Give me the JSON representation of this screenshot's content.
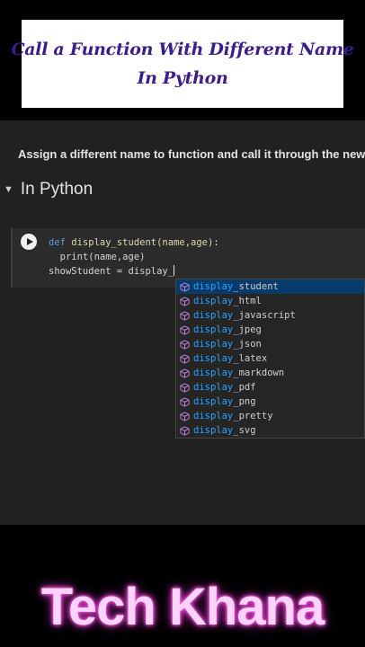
{
  "title": {
    "line1": "Call a Function With Different  Name",
    "line2": "In Python"
  },
  "instruction": "Assign a different name to function and call it through the new r",
  "section": {
    "caret_icon": "caret-down-icon",
    "title": "In Python"
  },
  "code": {
    "line1": {
      "keyword": "def",
      "rest": " display_student(name,age):"
    },
    "line2": "  print(name,age)",
    "line3": "showStudent = display_"
  },
  "autocomplete": {
    "typed": "display",
    "items": [
      {
        "match": "display",
        "rest": "_student"
      },
      {
        "match": "display",
        "rest": "_html"
      },
      {
        "match": "display",
        "rest": "_javascript"
      },
      {
        "match": "display",
        "rest": "_jpeg"
      },
      {
        "match": "display",
        "rest": "_json"
      },
      {
        "match": "display",
        "rest": "_latex"
      },
      {
        "match": "display",
        "rest": "_markdown"
      },
      {
        "match": "display",
        "rest": "_pdf"
      },
      {
        "match": "display",
        "rest": "_png"
      },
      {
        "match": "display",
        "rest": "_pretty"
      },
      {
        "match": "display",
        "rest": "_svg"
      }
    ],
    "selected_index": 0,
    "item_icon": "cube-icon"
  },
  "brand": "Tech Khana",
  "colors": {
    "title_text": "#3a1d8a",
    "match_highlight": "#2aa4ff",
    "selection_bg": "#063b6b",
    "brand_glow": "#ff4fe2",
    "cube_icon": "#b180d7"
  }
}
